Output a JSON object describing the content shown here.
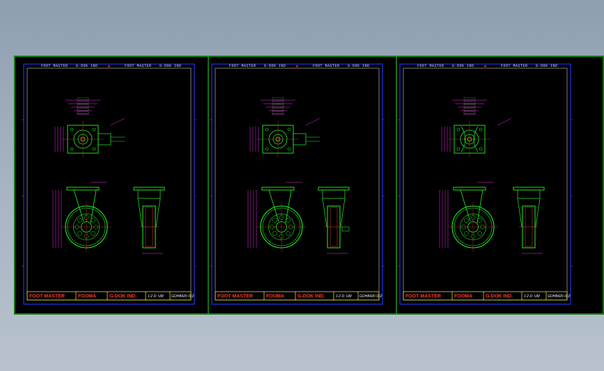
{
  "header": {
    "left_text": "FOOT MASTER",
    "mid_text": "G-DOK IND",
    "right_text": "FOOT MASTER",
    "right_mid_text": "G-DOK IND"
  },
  "title_block": {
    "brand1": "FOOT MASTER",
    "brand2": "FOOMA",
    "brand3": "G-DOK IND.",
    "spec1": "1:2 D: UM",
    "spec2": "GOH8420 /1:2"
  },
  "colors": {
    "background_gradient_top": "#8f9fb0",
    "canvas": "#000000",
    "frame_green": "#22ee22",
    "border_blue": "#2233ff",
    "drawing_green": "#22ff22",
    "dimension_magenta": "#ff33ff",
    "title_red": "#ff3b30",
    "title_yellow": "#ffff33"
  }
}
